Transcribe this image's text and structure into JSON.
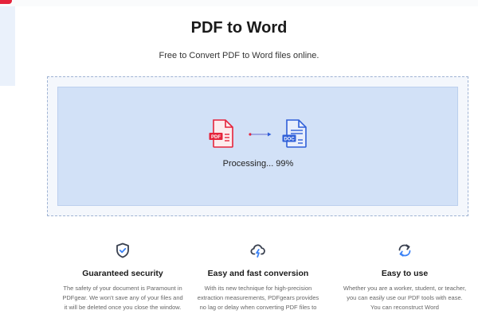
{
  "header": {
    "title": "PDF to Word",
    "subtitle": "Free to Convert PDF to Word files online."
  },
  "conversion": {
    "source_badge": "PDF",
    "target_badge": "DOC",
    "status_text": "Processing... 99%",
    "progress_percent": 99
  },
  "features": [
    {
      "icon": "shield-check-icon",
      "title": "Guaranteed security",
      "description": "The safety of your document is Paramount in PDFgear. We won't save any of your files and it will be deleted once you close the window."
    },
    {
      "icon": "cloud-lightning-icon",
      "title": "Easy and fast conversion",
      "description": "With its new technique for high-precision extraction measurements, PDFgears provides no lag or delay when converting PDF files to"
    },
    {
      "icon": "sync-arrows-icon",
      "title": "Easy to use",
      "description": "Whether you are a worker, student, or teacher, you can easily use our PDF tools with ease. You can reconstruct Word"
    }
  ],
  "colors": {
    "pdf_red": "#e5233b",
    "doc_blue": "#2f5fd8",
    "dropzone_fill": "#d2e1f7",
    "icon_dark": "#3a4150",
    "icon_accent": "#3b82f6"
  }
}
